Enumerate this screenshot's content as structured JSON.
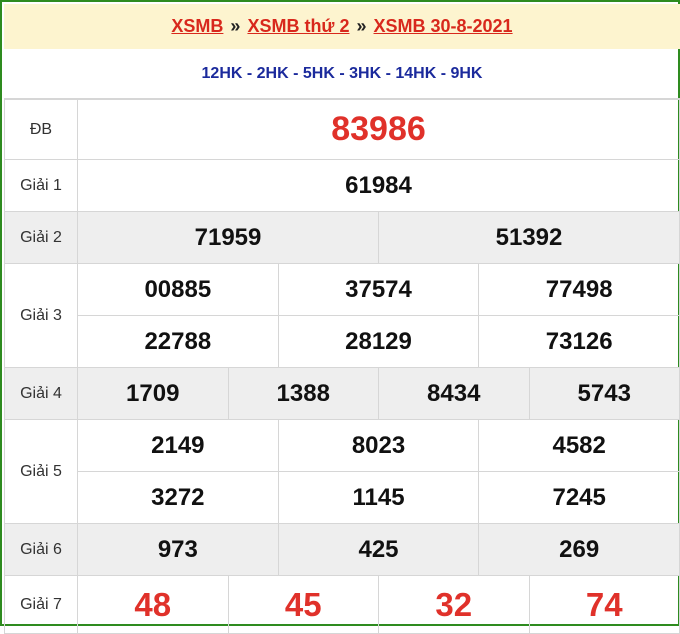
{
  "breadcrumb": {
    "item1": "XSMB",
    "item2": "XSMB thứ 2",
    "item3": "XSMB 30-8-2021",
    "separator": "»"
  },
  "codes": "12HK - 2HK - 5HK - 3HK - 14HK - 9HK",
  "labels": {
    "db": "ĐB",
    "g1": "Giải 1",
    "g2": "Giải 2",
    "g3": "Giải 3",
    "g4": "Giải 4",
    "g5": "Giải 5",
    "g6": "Giải 6",
    "g7": "Giải 7"
  },
  "prizes": {
    "db": [
      "83986"
    ],
    "g1": [
      "61984"
    ],
    "g2": [
      "71959",
      "51392"
    ],
    "g3": [
      "00885",
      "37574",
      "77498",
      "22788",
      "28129",
      "73126"
    ],
    "g4": [
      "1709",
      "1388",
      "8434",
      "5743"
    ],
    "g5": [
      "2149",
      "8023",
      "4582",
      "3272",
      "1145",
      "7245"
    ],
    "g6": [
      "973",
      "425",
      "269"
    ],
    "g7": [
      "48",
      "45",
      "32",
      "74"
    ]
  },
  "colors": {
    "border": "#2e8b1f",
    "breadcrumb_bg": "#fdf4cf",
    "link": "#d8281c",
    "codes": "#1b2a9c",
    "special": "#e0312a",
    "shade": "#eeeeee"
  }
}
